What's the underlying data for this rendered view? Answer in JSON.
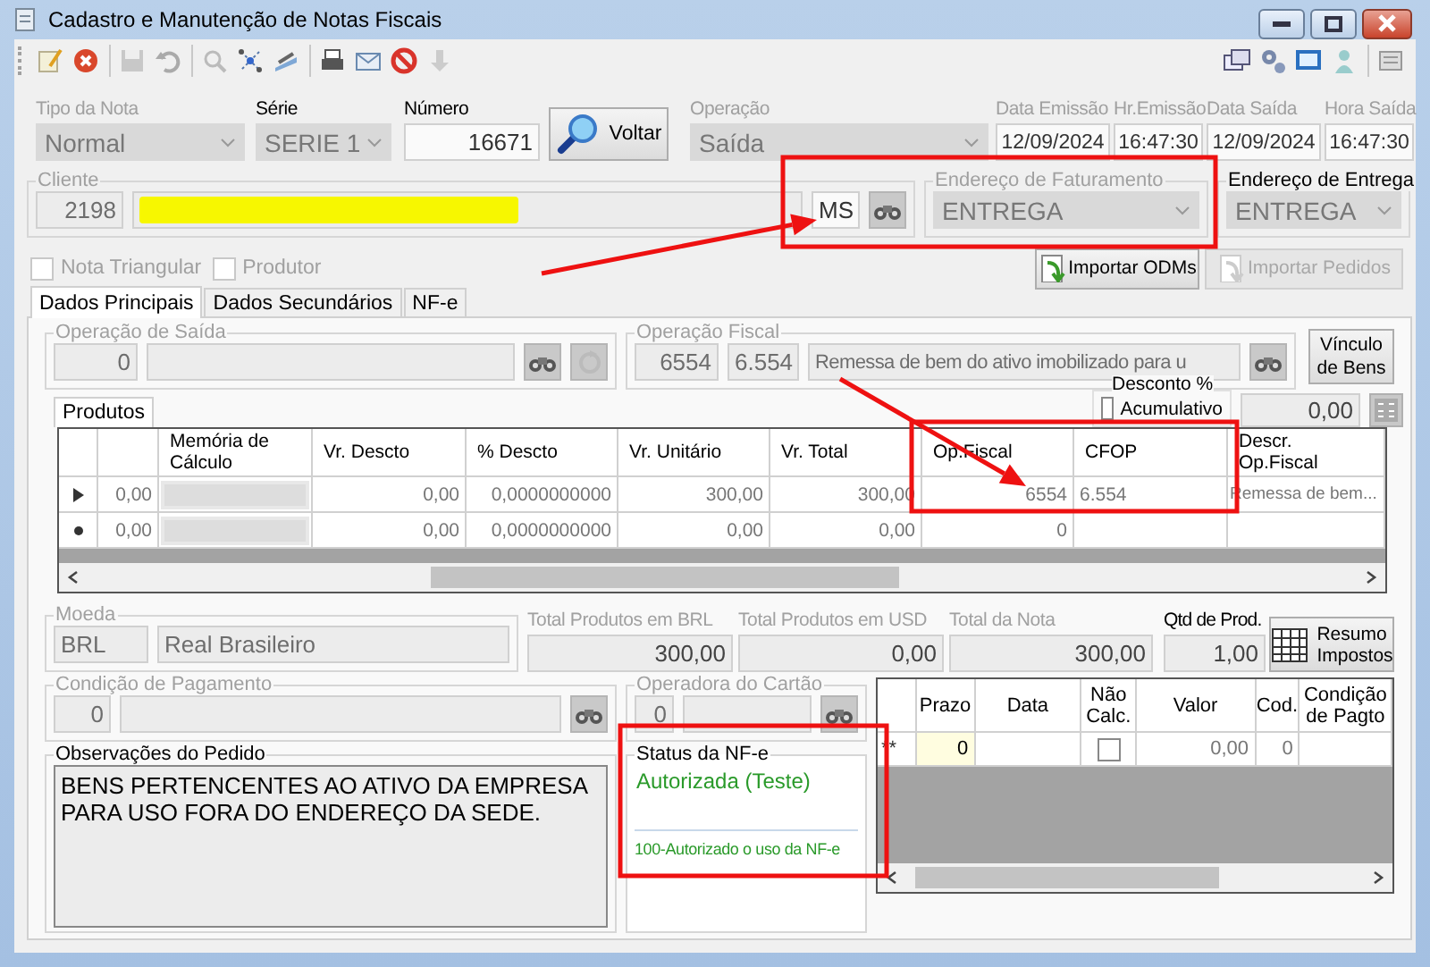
{
  "window": {
    "title": "Cadastro e Manutenção de Notas Fiscais"
  },
  "header": [
    {
      "kind": "combo",
      "label": "Tipo da Nota",
      "value": "Normal",
      "disabled": true
    },
    {
      "kind": "combo",
      "label": "Série",
      "value": "SERIE 1",
      "disabled": false
    },
    {
      "kind": "number",
      "label": "Número",
      "value": "16671",
      "disabled": false
    },
    {
      "kind": "button",
      "label": "Voltar"
    },
    {
      "kind": "combo",
      "label": "Operação",
      "value": "Saída",
      "disabled": true
    },
    {
      "kind": "text",
      "label": "Data Emissão",
      "value": "12/09/2024",
      "disabled": true
    },
    {
      "kind": "text",
      "label": "Hr.Emissão",
      "value": "16:47:30",
      "disabled": true
    },
    {
      "kind": "text",
      "label": "Data Saída",
      "value": "12/09/2024",
      "disabled": true
    },
    {
      "kind": "text",
      "label": "Hora Saída",
      "value": "16:47:30",
      "disabled": true
    }
  ],
  "cliente": {
    "label": "Cliente",
    "code": "2198",
    "name_highlighted": true,
    "uf": "MS"
  },
  "endereco_faturamento": {
    "label": "Endereço de Faturamento",
    "value": "ENTREGA",
    "disabled": true
  },
  "endereco_entrega": {
    "label": "Endereço de Entrega",
    "value": "ENTREGA",
    "disabled": false
  },
  "checkboxes": [
    {
      "label": "Nota Triangular",
      "checked": false,
      "disabled": true
    },
    {
      "label": "Produtor",
      "checked": false,
      "disabled": true
    }
  ],
  "import_buttons": [
    {
      "label": "Importar ODMs",
      "disabled": false
    },
    {
      "label": "Importar Pedidos",
      "disabled": true
    }
  ],
  "tabs": [
    {
      "label": "Dados Principais",
      "selected": true
    },
    {
      "label": "Dados Secundários",
      "selected": false
    },
    {
      "label": "NF-e",
      "selected": false
    }
  ],
  "operacao_saida": {
    "label": "Operação de Saída",
    "code": "0"
  },
  "operacao_fiscal": {
    "label": "Operação Fiscal",
    "code": "6554",
    "cfop": "6.554",
    "description": "Remessa de bem do ativo imobilizado para u"
  },
  "vinculo_button": "Vínculo de Bens",
  "desconto": {
    "title": "Desconto %",
    "checkbox_label": "Acumulativo",
    "checked": false,
    "value": "0,00"
  },
  "products": {
    "tab": "Produtos",
    "columns": {
      "memoria_de_calculo": "Memória de Cálculo",
      "vr_descto": "Vr. Descto",
      "pct_descto": "% Descto",
      "vr_unitario": "Vr. Unitário",
      "vr_total": "Vr. Total",
      "op_fiscal": "Op.Fiscal",
      "cfop": "CFOP",
      "descr_op_fiscal": "Descr. Op.Fiscal"
    },
    "rows": [
      {
        "kind": "current",
        "column_1": "0,00",
        "vr_descto": "0,00",
        "pct_descto": "0,0000000000",
        "vr_unitario": "300,00",
        "vr_total": "300,00",
        "op_fiscal": "6554",
        "cfop": "6.554",
        "descr_op_fiscal": "Remessa de bem..."
      },
      {
        "kind": "new",
        "column_1": "0,00",
        "vr_descto": "0,00",
        "pct_descto": "0,0000000000",
        "vr_unitario": "0,00",
        "vr_total": "0,00",
        "op_fiscal": "0"
      }
    ]
  },
  "moeda": {
    "label": "Moeda",
    "code": "BRL",
    "name": "Real Brasileiro"
  },
  "totals": [
    {
      "label": "Total Produtos em BRL",
      "value": "300,00",
      "disabled": true
    },
    {
      "label": "Total Produtos em USD",
      "value": "0,00",
      "disabled": true
    },
    {
      "label": "Total da Nota",
      "value": "300,00",
      "disabled": true
    },
    {
      "label": "Qtd de Prod.",
      "value": "1,00",
      "disabled": false
    }
  ],
  "resumo_button": "Resumo Impostos",
  "condicao_pagamento": {
    "label": "Condição de Pagamento",
    "code": "0"
  },
  "operadora_cartao": {
    "label": "Operadora do Cartão",
    "code": "0"
  },
  "observacoes": {
    "label": "Observações do Pedido",
    "text": "BENS PERTENCENTES AO ATIVO DA EMPRESA PARA USO FORA DO ENDEREÇO DA SEDE."
  },
  "status_nfe": {
    "label": "Status da NF-e",
    "status": "Autorizada (Teste)",
    "message": "100-Autorizado o uso da NF-e"
  },
  "payments": {
    "columns": {
      "prazo": "Prazo",
      "data": "Data",
      "nao_calc": "Não Calc.",
      "valor": "Valor",
      "cod": "Cod.",
      "condicao_de_pagto": "Condição de Pagto"
    },
    "rows": [
      {
        "marker": "**",
        "prazo": "0",
        "nao_calc": false,
        "valor": "0,00",
        "cod": "0"
      }
    ]
  },
  "annotations": [
    {
      "kind": "box"
    },
    {
      "kind": "box"
    },
    {
      "kind": "box"
    },
    {
      "kind": "arrow"
    },
    {
      "kind": "arrow"
    }
  ]
}
